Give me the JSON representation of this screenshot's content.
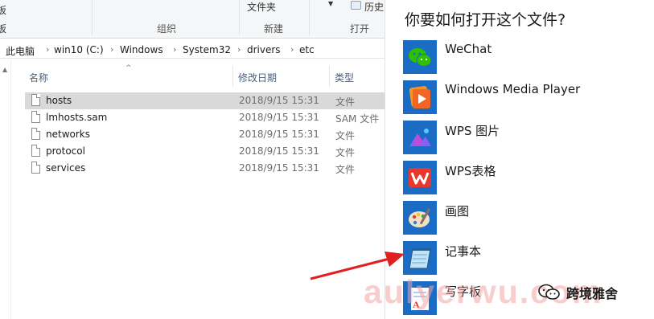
{
  "ribbon": {
    "partial_left": "板",
    "partial_bottom_left": "板",
    "new_folder": "文件夹",
    "history": "历史",
    "groups": {
      "organize": "组织",
      "new": "新建",
      "open": "打开"
    }
  },
  "address_bar": {
    "crumbs": [
      "此电脑",
      "win10 (C:)",
      "Windows",
      "System32",
      "drivers",
      "etc"
    ]
  },
  "file_list": {
    "columns": {
      "name": "名称",
      "date": "修改日期",
      "type": "类型"
    },
    "rows": [
      {
        "name": "hosts",
        "date": "2018/9/15 15:31",
        "type": "文件",
        "selected": true
      },
      {
        "name": "lmhosts.sam",
        "date": "2018/9/15 15:31",
        "type": "SAM 文件",
        "selected": false
      },
      {
        "name": "networks",
        "date": "2018/9/15 15:31",
        "type": "文件",
        "selected": false
      },
      {
        "name": "protocol",
        "date": "2018/9/15 15:31",
        "type": "文件",
        "selected": false
      },
      {
        "name": "services",
        "date": "2018/9/15 15:31",
        "type": "文件",
        "selected": false
      }
    ]
  },
  "open_with": {
    "title": "你要如何打开这个文件?",
    "apps": [
      {
        "label": "WeChat",
        "icon": "wechat-icon"
      },
      {
        "label": "Windows Media Player",
        "icon": "media-player-icon"
      },
      {
        "label": "WPS 图片",
        "icon": "wps-picture-icon"
      },
      {
        "label": "WPS表格",
        "icon": "wps-spreadsheet-icon"
      },
      {
        "label": "画图",
        "icon": "paint-icon"
      },
      {
        "label": "记事本",
        "icon": "notepad-icon"
      },
      {
        "label": "写字板",
        "icon": "wordpad-icon"
      }
    ]
  },
  "watermark": {
    "text": "aulyerwu.com"
  },
  "brand": {
    "text": "跨境雅舍"
  },
  "colors": {
    "arrow": "#e02020",
    "selected_row": "#d9d9d9",
    "app_tile": "#1a6cc4"
  }
}
